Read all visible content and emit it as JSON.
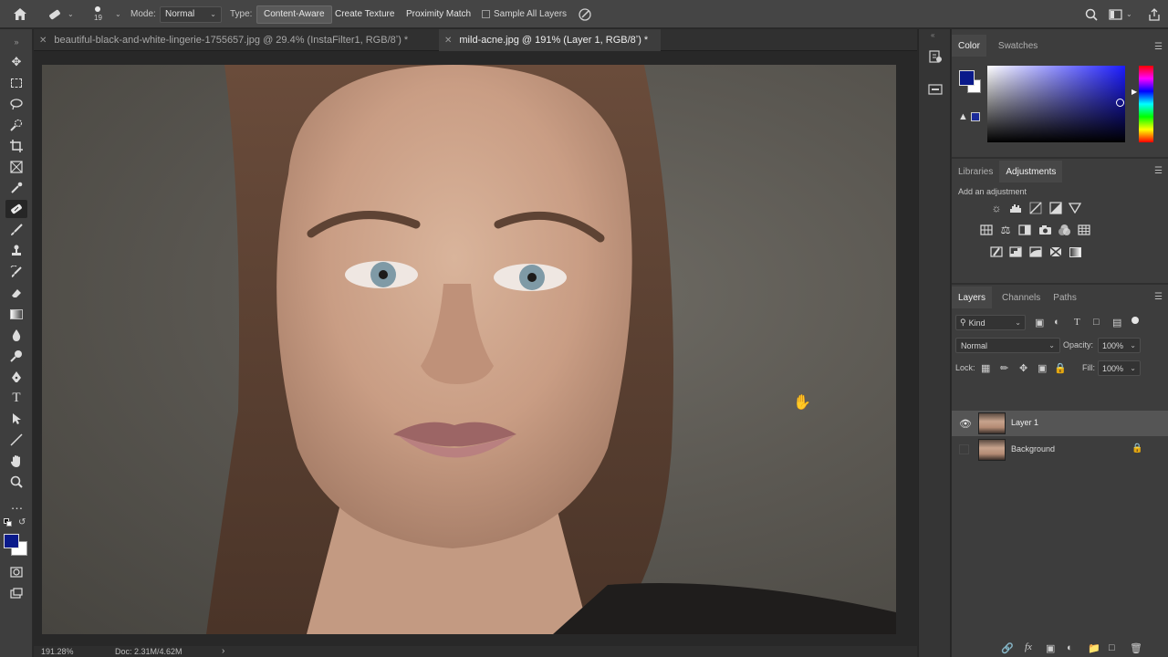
{
  "options_bar": {
    "home_icon": "home-icon",
    "brush_size": "19",
    "mode_label": "Mode:",
    "mode_value": "Normal",
    "type_label": "Type:",
    "type_options": [
      "Content-Aware",
      "Create Texture",
      "Proximity Match"
    ],
    "selected_type": "Content-Aware",
    "sample_all_layers": "Sample All Layers"
  },
  "tabs": [
    {
      "label": "beautiful-black-and-white-lingerie-1755657.jpg @ 29.4% (InstaFilter1, RGB/8ʼ) *",
      "active": false
    },
    {
      "label": "mild-acne.jpg @ 191% (Layer 1, RGB/8ʼ) *",
      "active": true
    }
  ],
  "status": {
    "zoom": "191.28%",
    "doc": "Doc: 2.31M/4.62M"
  },
  "color_panel": {
    "tabs": [
      "Color",
      "Swatches"
    ],
    "foreground": "#0a1a8a",
    "background": "#ffffff"
  },
  "adjustments_panel": {
    "tabs": [
      "Libraries",
      "Adjustments"
    ],
    "hint": "Add an adjustment"
  },
  "layers_panel": {
    "tabs": [
      "Layers",
      "Channels",
      "Paths"
    ],
    "filter_kind": "Kind",
    "blend_mode": "Normal",
    "opacity_label": "Opacity:",
    "opacity_value": "100%",
    "lock_label": "Lock:",
    "fill_label": "Fill:",
    "fill_value": "100%",
    "layers": [
      {
        "name": "Layer 1",
        "visible": true,
        "selected": true
      },
      {
        "name": "Background",
        "visible": false,
        "locked": true
      }
    ]
  }
}
